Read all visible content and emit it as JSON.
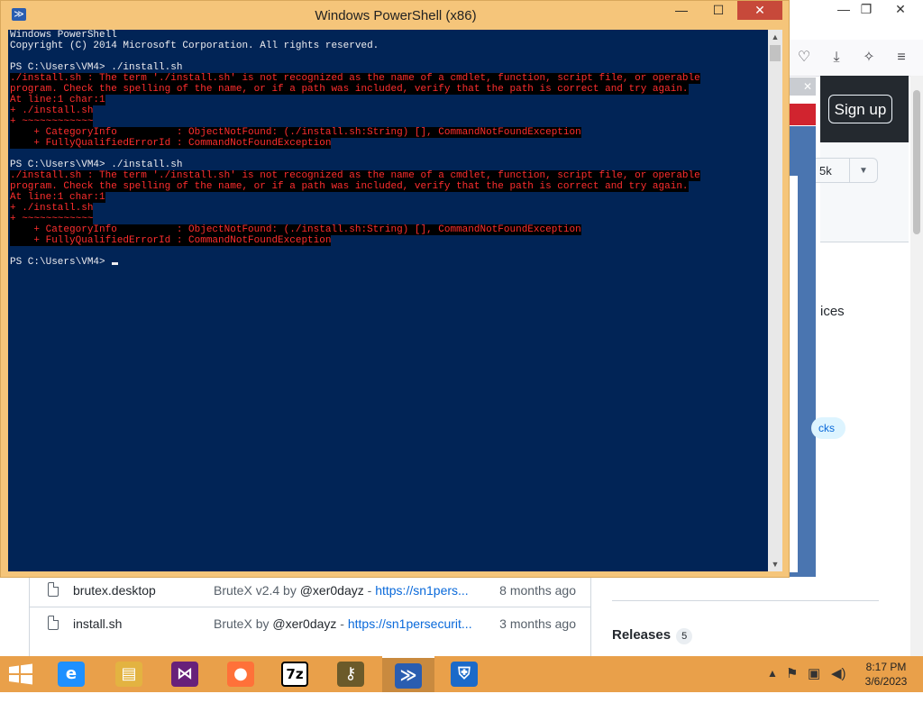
{
  "browser": {
    "signup_label": "Sign up",
    "star_count": "5k",
    "services_text": "ices",
    "pill_text": "cks",
    "files": [
      {
        "name": "brutex.desktop",
        "msg_prefix": "BruteX v2.4 by ",
        "author": "@xer0dayz",
        "sep": " - ",
        "link": "https://sn1pers...",
        "age": "8 months ago"
      },
      {
        "name": "install.sh",
        "msg_prefix": "BruteX by ",
        "author": "@xer0dayz",
        "sep": " - ",
        "link": "https://sn1persecurit...",
        "age": "3 months ago"
      }
    ],
    "releases_label": "Releases",
    "releases_count": "5"
  },
  "powershell": {
    "title": "Windows PowerShell (x86)",
    "lines": [
      {
        "text": "Windows PowerShell",
        "kind": "white"
      },
      {
        "text": "Copyright (C) 2014 Microsoft Corporation. All rights reserved.",
        "kind": "white"
      },
      {
        "text": "",
        "kind": "white"
      },
      {
        "text": "PS C:\\Users\\VM4> ./install.sh",
        "kind": "white"
      },
      {
        "text": "./install.sh : The term './install.sh' is not recognized as the name of a cmdlet, function, script file, or operable",
        "kind": "err"
      },
      {
        "text": "program. Check the spelling of the name, or if a path was included, verify that the path is correct and try again.",
        "kind": "err"
      },
      {
        "text": "At line:1 char:1",
        "kind": "err"
      },
      {
        "text": "+ ./install.sh",
        "kind": "err"
      },
      {
        "text": "+ ~~~~~~~~~~~~",
        "kind": "err"
      },
      {
        "text": "    + CategoryInfo          : ObjectNotFound: (./install.sh:String) [], CommandNotFoundException",
        "kind": "err"
      },
      {
        "text": "    + FullyQualifiedErrorId : CommandNotFoundException",
        "kind": "err"
      },
      {
        "text": "",
        "kind": "white"
      },
      {
        "text": "PS C:\\Users\\VM4> ./install.sh",
        "kind": "white"
      },
      {
        "text": "./install.sh : The term './install.sh' is not recognized as the name of a cmdlet, function, script file, or operable",
        "kind": "err"
      },
      {
        "text": "program. Check the spelling of the name, or if a path was included, verify that the path is correct and try again.",
        "kind": "err"
      },
      {
        "text": "At line:1 char:1",
        "kind": "err"
      },
      {
        "text": "+ ./install.sh",
        "kind": "err"
      },
      {
        "text": "+ ~~~~~~~~~~~~",
        "kind": "err"
      },
      {
        "text": "    + CategoryInfo          : ObjectNotFound: (./install.sh:String) [], CommandNotFoundException",
        "kind": "err"
      },
      {
        "text": "    + FullyQualifiedErrorId : CommandNotFoundException",
        "kind": "err"
      },
      {
        "text": "",
        "kind": "white"
      },
      {
        "text": "PS C:\\Users\\VM4> ",
        "kind": "prompt"
      }
    ]
  },
  "taskbar": {
    "apps": [
      {
        "name": "internet-explorer-icon",
        "glyph": "e",
        "color": "#1e90ff",
        "active": false
      },
      {
        "name": "file-explorer-icon",
        "glyph": "▤",
        "color": "#e3b341",
        "active": false
      },
      {
        "name": "visual-studio-icon",
        "glyph": "⋈",
        "color": "#68217a",
        "active": false
      },
      {
        "name": "firefox-icon",
        "glyph": "●",
        "color": "#ff7139",
        "active": false
      },
      {
        "name": "7zip-icon",
        "glyph": "7z",
        "color": "#000000",
        "active": false
      },
      {
        "name": "keys-icon",
        "glyph": "⚷",
        "color": "#6b5a2a",
        "active": false
      },
      {
        "name": "powershell-icon",
        "glyph": "≫",
        "color": "#2a5db0",
        "active": true
      },
      {
        "name": "defender-icon",
        "glyph": "⛨",
        "color": "#1b6ac9",
        "active": false
      }
    ],
    "time": "8:17 PM",
    "date": "3/6/2023"
  },
  "colors": {
    "console_bg": "#012456",
    "error_fg": "#ff2e2e",
    "taskbar_bg": "#e9a04a",
    "window_frame": "#f5c57a"
  }
}
